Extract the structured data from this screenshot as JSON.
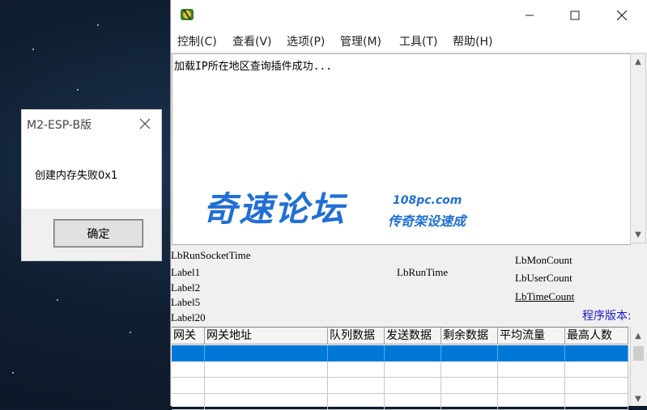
{
  "dialog": {
    "title": "M2-ESP-B版",
    "message": "创建内存失败0x1",
    "ok_label": "确定"
  },
  "main_window": {
    "menu": [
      {
        "label": "控制(C)"
      },
      {
        "label": "查看(V)"
      },
      {
        "label": "选项(P)"
      },
      {
        "label": "管理(M)"
      },
      {
        "label": "工具(T)"
      },
      {
        "label": "帮助(H)"
      }
    ],
    "log_text": "加载IP所在地区查询插件成功...",
    "status": {
      "lb_run_socket_time": "LbRunSocketTime",
      "label1": "Label1",
      "label2": "Label2",
      "label5": "Label5",
      "label20": "Label20",
      "lb_run_time": "LbRunTime",
      "lb_mon_count": "LbMonCount",
      "lb_user_count": "LbUserCount",
      "lb_time_count": "LbTimeCount",
      "program_version": "程序版本:"
    },
    "table": {
      "columns": [
        "网关",
        "网关地址",
        "队列数据",
        "发送数据",
        "剩余数据",
        "平均流量",
        "最高人数"
      ],
      "rows": [
        [],
        [],
        [],
        []
      ]
    }
  },
  "watermark": {
    "title": "奇速论坛",
    "domain": "108pc.com",
    "subtitle": "传奇架设速成"
  }
}
